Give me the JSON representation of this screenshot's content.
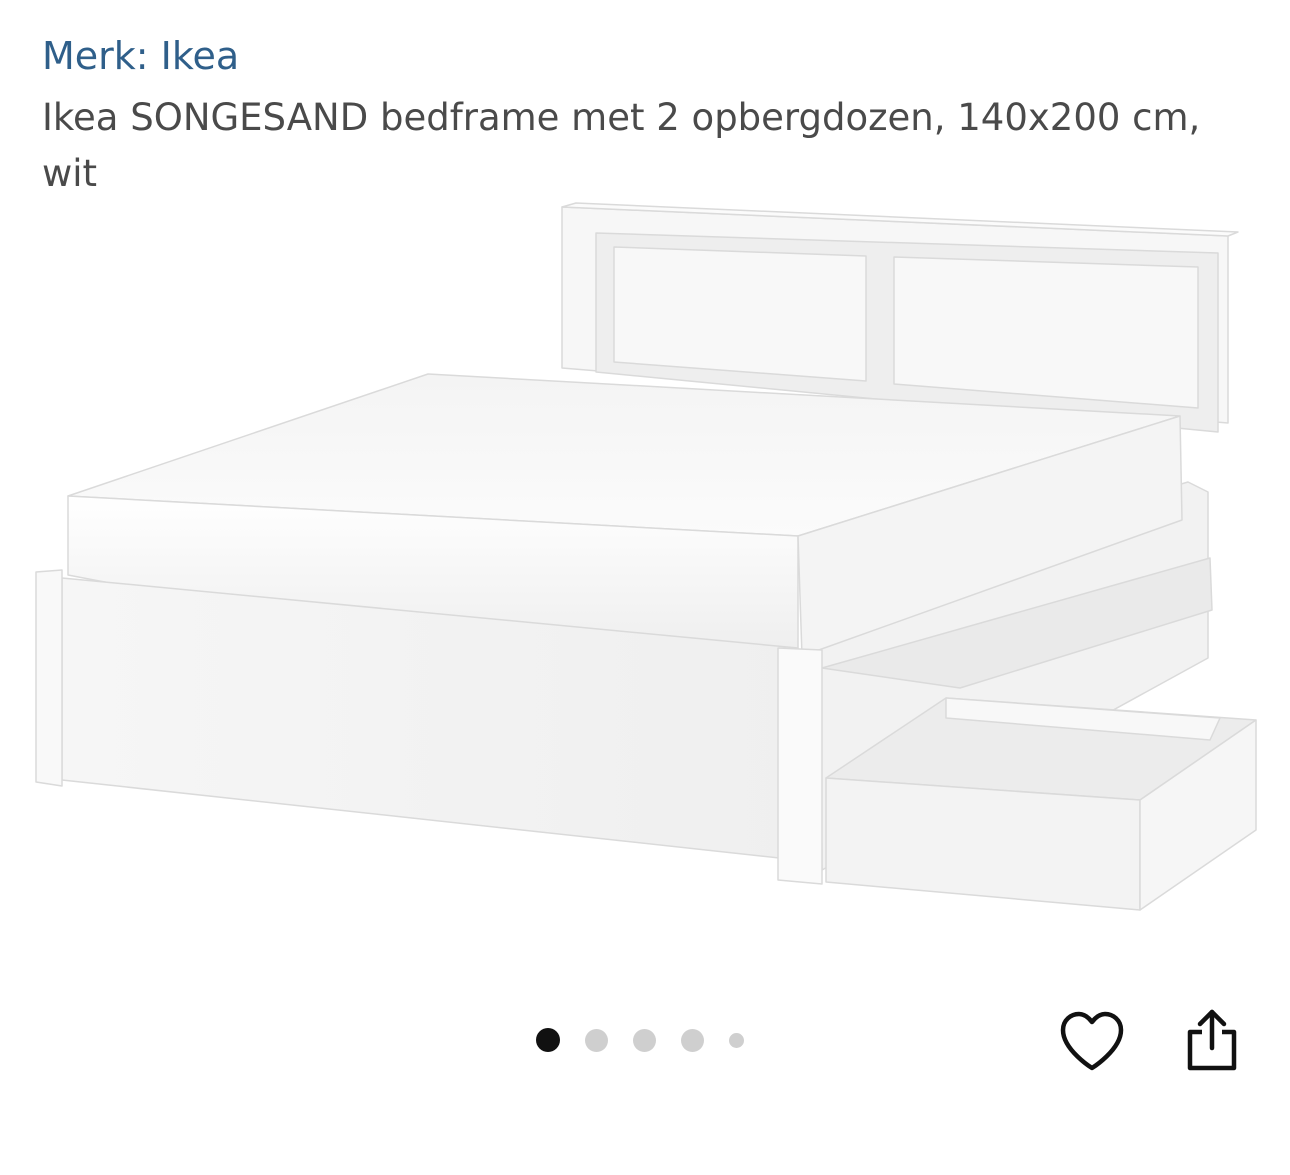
{
  "product": {
    "brand_link": "Merk: Ikea",
    "title": "Ikea SONGESAND bedframe met 2 opbergdozen, 140x200 cm, wit"
  },
  "gallery": {
    "image_subject": "white bed frame with mattress and open storage drawer",
    "total_images": 5,
    "active_index": 0
  },
  "actions": {
    "favorite_icon": "heart-icon",
    "share_icon": "share-icon"
  },
  "colors": {
    "brand_link": "#2F5F8A",
    "title": "#4A4A4A",
    "dot_active": "#111111",
    "dot_inactive": "#CFCFCF"
  }
}
